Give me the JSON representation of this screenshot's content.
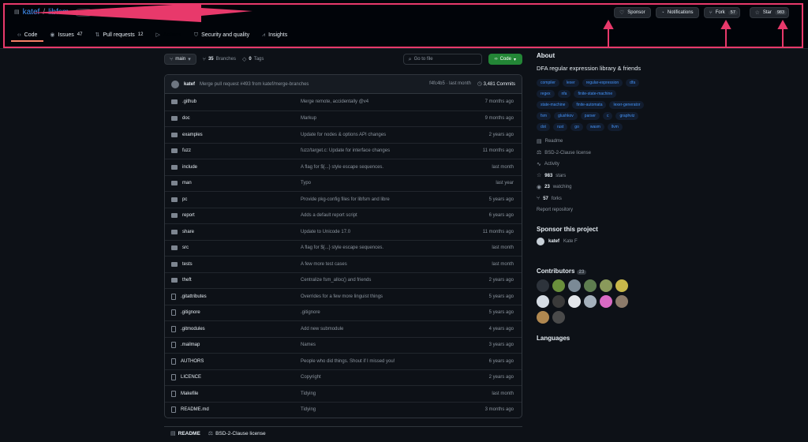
{
  "header": {
    "owner": "katef",
    "name": "libfsm",
    "visibility": "Public",
    "actions": [
      {
        "label": "Sponsor",
        "icon": "heart-icon"
      },
      {
        "label": "Notifications",
        "icon": "bell-icon"
      },
      {
        "label": "Fork",
        "count": "57",
        "icon": "fork-icon"
      },
      {
        "label": "Star",
        "count": "983",
        "icon": "star-icon"
      }
    ],
    "tabs": [
      {
        "label": "Code",
        "icon": "code-icon",
        "active": true
      },
      {
        "label": "Issues",
        "count": "47",
        "icon": "issue-icon"
      },
      {
        "label": "Pull requests",
        "count": "12",
        "icon": "pr-icon"
      },
      {
        "label": "Actions",
        "icon": "play-icon"
      },
      {
        "label": "Security and quality",
        "icon": "shield-icon"
      },
      {
        "label": "Insights",
        "icon": "graph-icon"
      }
    ]
  },
  "toolbar": {
    "branch": "main",
    "branches_count": "35",
    "branches_label": "Branches",
    "tags_count": "0",
    "tags_label": "Tags",
    "goto": "Go to file",
    "code_btn": "Code"
  },
  "commit": {
    "author": "katef",
    "message": "Merge pull request #493 from katef/merge-branches",
    "hash": "f4fc4b5 · last month",
    "count": "3,481 Commits"
  },
  "files": [
    {
      "name": ".github",
      "type": "dir",
      "message": "Merge remote, accidentally @v4",
      "date": "7 months ago"
    },
    {
      "name": "doc",
      "type": "dir",
      "message": "Markup",
      "date": "9 months ago"
    },
    {
      "name": "examples",
      "type": "dir",
      "message": "Update for nodes & options API changes",
      "date": "2 years ago"
    },
    {
      "name": "fuzz",
      "type": "dir",
      "message": "fuzz/target.c: Update for interface changes",
      "date": "11 months ago"
    },
    {
      "name": "include",
      "type": "dir",
      "message": "A flag for ${...} style escape sequences.",
      "date": "last month"
    },
    {
      "name": "man",
      "type": "dir",
      "message": "Typo",
      "date": "last year"
    },
    {
      "name": "pc",
      "type": "dir",
      "message": "Provide pkg-config files for libfsm and libre",
      "date": "5 years ago"
    },
    {
      "name": "report",
      "type": "dir",
      "message": "Adds a default report script",
      "date": "6 years ago"
    },
    {
      "name": "share",
      "type": "dir",
      "message": "Update to Unicode 17.0",
      "date": "11 months ago"
    },
    {
      "name": "src",
      "type": "dir",
      "message": "A flag for ${...} style escape sequences.",
      "date": "last month"
    },
    {
      "name": "tests",
      "type": "dir",
      "message": "A few more test cases",
      "date": "last month"
    },
    {
      "name": "theft",
      "type": "dir",
      "message": "Centralize fsm_alloc() and friends",
      "date": "2 years ago"
    },
    {
      "name": ".gitattributes",
      "type": "file",
      "message": "Overrides for a few more linguist things",
      "date": "5 years ago"
    },
    {
      "name": ".gitignore",
      "type": "file",
      "message": ".gitignore",
      "date": "5 years ago"
    },
    {
      "name": ".gitmodules",
      "type": "file",
      "message": "Add new submodule",
      "date": "4 years ago"
    },
    {
      "name": ".mailmap",
      "type": "file",
      "message": "Names",
      "date": "3 years ago"
    },
    {
      "name": "AUTHORS",
      "type": "file",
      "message": "People who did things. Shout if I missed you!",
      "date": "6 years ago"
    },
    {
      "name": "LICENCE",
      "type": "file",
      "message": "Copyright",
      "date": "2 years ago"
    },
    {
      "name": "Makefile",
      "type": "file",
      "message": "Tidying",
      "date": "last month"
    },
    {
      "name": "README.md",
      "type": "file",
      "message": "Tidying",
      "date": "3 months ago"
    }
  ],
  "readme_bar": {
    "readme": "README",
    "license": "BSD-2-Clause license"
  },
  "about": {
    "title": "About",
    "description": "DFA regular expression library & friends",
    "topics": [
      "compiler",
      "lexer",
      "regular-expression",
      "dfa",
      "regex",
      "nfa",
      "finite-state-machine",
      "state-machine",
      "finite-automata",
      "lexer-generator",
      "fsm",
      "glushkov",
      "parser",
      "c",
      "graphviz",
      "dot",
      "rust",
      "go",
      "wasm",
      "llvm"
    ],
    "links": [
      {
        "icon": "book-icon",
        "label": "Readme"
      },
      {
        "icon": "law-icon",
        "label": "BSD-2-Clause license"
      },
      {
        "icon": "pulse-icon",
        "label": "Activity"
      },
      {
        "icon": "star-icon",
        "count": "983",
        "label": "stars"
      },
      {
        "icon": "eye-icon",
        "count": "23",
        "label": "watching"
      },
      {
        "icon": "fork-icon",
        "count": "57",
        "label": "forks"
      },
      {
        "icon": "",
        "label": "Report repository"
      }
    ]
  },
  "sponsor": {
    "title": "Sponsor this project",
    "user": "katef",
    "name": "Kate F"
  },
  "contributors": {
    "title": "Contributors",
    "count": "23"
  },
  "languages": {
    "title": "Languages"
  },
  "colors": {
    "accent": "#e8396b",
    "link": "#4493f8",
    "green": "#238636"
  }
}
